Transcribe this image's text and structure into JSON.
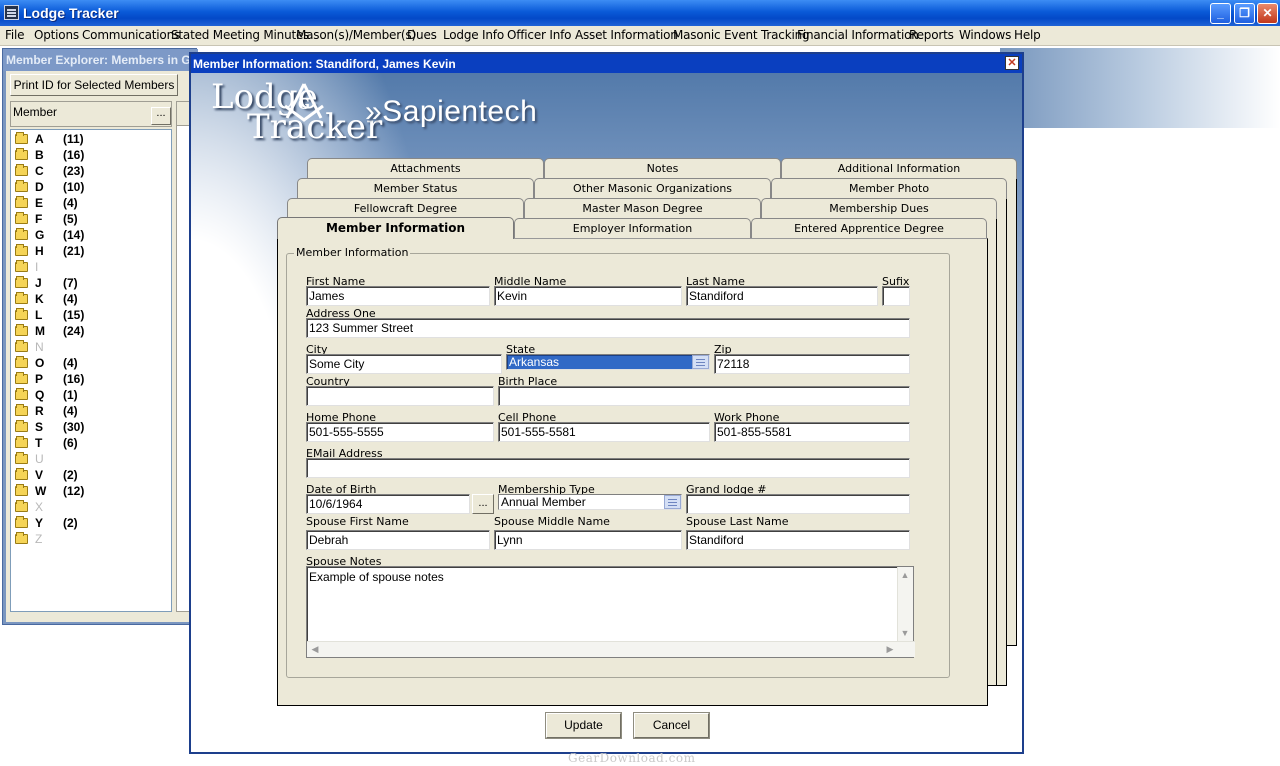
{
  "app": {
    "title": "Lodge Tracker",
    "menu": [
      "File",
      "Options",
      "Communications",
      "Stated Meeting Minutes",
      "Mason(s)/Member(s)",
      "Dues",
      "Lodge Info",
      "Officer Info",
      "Asset Information",
      "Masonic Event Tracking",
      "Financial Information",
      "Reports",
      "Windows",
      "Help"
    ],
    "window_buttons": {
      "minimize": "_",
      "restore": "❐",
      "close": "✕"
    }
  },
  "explorer": {
    "title": "Member Explorer: Members in Go",
    "print_button": "Print ID for Selected Members",
    "column_header": "Member",
    "browse_button": "...",
    "letters": [
      {
        "letter": "A",
        "count": "(11)"
      },
      {
        "letter": "B",
        "count": "(16)"
      },
      {
        "letter": "C",
        "count": "(23)"
      },
      {
        "letter": "D",
        "count": "(10)"
      },
      {
        "letter": "E",
        "count": "(4)"
      },
      {
        "letter": "F",
        "count": "(5)"
      },
      {
        "letter": "G",
        "count": "(14)"
      },
      {
        "letter": "H",
        "count": "(21)"
      },
      {
        "letter": "I",
        "count": ""
      },
      {
        "letter": "J",
        "count": "(7)"
      },
      {
        "letter": "K",
        "count": "(4)"
      },
      {
        "letter": "L",
        "count": "(15)"
      },
      {
        "letter": "M",
        "count": "(24)"
      },
      {
        "letter": "N",
        "count": ""
      },
      {
        "letter": "O",
        "count": "(4)"
      },
      {
        "letter": "P",
        "count": "(16)"
      },
      {
        "letter": "Q",
        "count": "(1)"
      },
      {
        "letter": "R",
        "count": "(4)"
      },
      {
        "letter": "S",
        "count": "(30)"
      },
      {
        "letter": "T",
        "count": "(6)"
      },
      {
        "letter": "U",
        "count": ""
      },
      {
        "letter": "V",
        "count": "(2)"
      },
      {
        "letter": "W",
        "count": "(12)"
      },
      {
        "letter": "X",
        "count": ""
      },
      {
        "letter": "Y",
        "count": "(2)"
      },
      {
        "letter": "Z",
        "count": ""
      }
    ]
  },
  "dialog": {
    "title": "Member Information: Standiford, James Kevin",
    "close": "✕",
    "logo_line1": "Lodge",
    "logo_line2": "Tracker",
    "brand": "»Sapientech",
    "tabs_row1": [
      "Attachments",
      "Notes",
      "Additional Information"
    ],
    "tabs_row2": [
      "Member Status",
      "Other Masonic Organizations",
      "Member Photo"
    ],
    "tabs_row3": [
      "Fellowcraft Degree",
      "Master Mason Degree",
      "Membership Dues"
    ],
    "tabs_row4": [
      "Member Information",
      "Employer Information",
      "Entered Apprentice Degree"
    ],
    "group_label": "Member Information",
    "labels": {
      "first_name": "First Name",
      "middle_name": "Middle Name",
      "last_name": "Last Name",
      "suffix": "Sufix",
      "address_one": "Address One",
      "city": "City",
      "state": "State",
      "zip": "Zip",
      "country": "Country",
      "birth_place": "Birth Place",
      "home_phone": "Home Phone",
      "cell_phone": "Cell Phone",
      "work_phone": "Work Phone",
      "email": "EMail Address",
      "dob": "Date of Birth",
      "membership_type": "Membership Type",
      "grand_lodge": "Grand lodge #",
      "spouse_first": "Spouse First Name",
      "spouse_middle": "Spouse Middle Name",
      "spouse_last": "Spouse Last Name",
      "spouse_notes": "Spouse Notes"
    },
    "values": {
      "first_name": "James",
      "middle_name": "Kevin",
      "last_name": "Standiford",
      "suffix": "",
      "address_one": "123 Summer Street",
      "city": "Some City",
      "state": "Arkansas",
      "zip": "72118",
      "country": "",
      "birth_place": "",
      "home_phone": "501-555-5555",
      "cell_phone": "501-555-5581",
      "work_phone": "501-855-5581",
      "email": "",
      "dob": "10/6/1964",
      "membership_type": "Annual Member",
      "grand_lodge": "",
      "spouse_first": "Debrah",
      "spouse_middle": "Lynn",
      "spouse_last": "Standiford",
      "spouse_notes": "Example of spouse notes"
    },
    "dob_button": "...",
    "update_button": "Update",
    "cancel_button": "Cancel"
  },
  "watermark": "GearDownload.com",
  "colors": {
    "titlebar": "#0a5ad8",
    "dialog_title": "#0a3fbf",
    "window_bg": "#ece9d8",
    "selection": "#3169c6"
  }
}
